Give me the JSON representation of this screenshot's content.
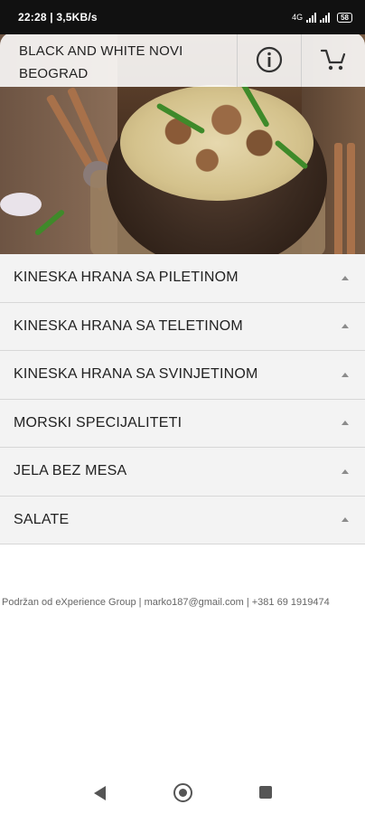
{
  "status_bar": {
    "time_speed": "22:28 | 3,5KB/s",
    "network": "4G",
    "battery": "58"
  },
  "header": {
    "title_line1": "BLACK AND WHITE NOVI",
    "title_line2": "BEOGRAD",
    "info_icon": "info-circle-icon",
    "cart_icon": "cart-icon"
  },
  "categories": [
    {
      "label": "KINESKA HRANA SA PILETINOM"
    },
    {
      "label": "KINESKA HRANA SA TELETINOM"
    },
    {
      "label": "KINESKA HRANA SA SVINJETINOM"
    },
    {
      "label": "MORSKI SPECIJALITETI"
    },
    {
      "label": "JELA BEZ MESA"
    },
    {
      "label": "SALATE"
    }
  ],
  "footer": {
    "text": "Podržan od eXperience Group | marko187@gmail.com | +381 69 1919474"
  },
  "navigation": {
    "back_icon": "back-triangle-icon",
    "home_icon": "home-circle-icon",
    "recent_icon": "recent-square-icon"
  }
}
